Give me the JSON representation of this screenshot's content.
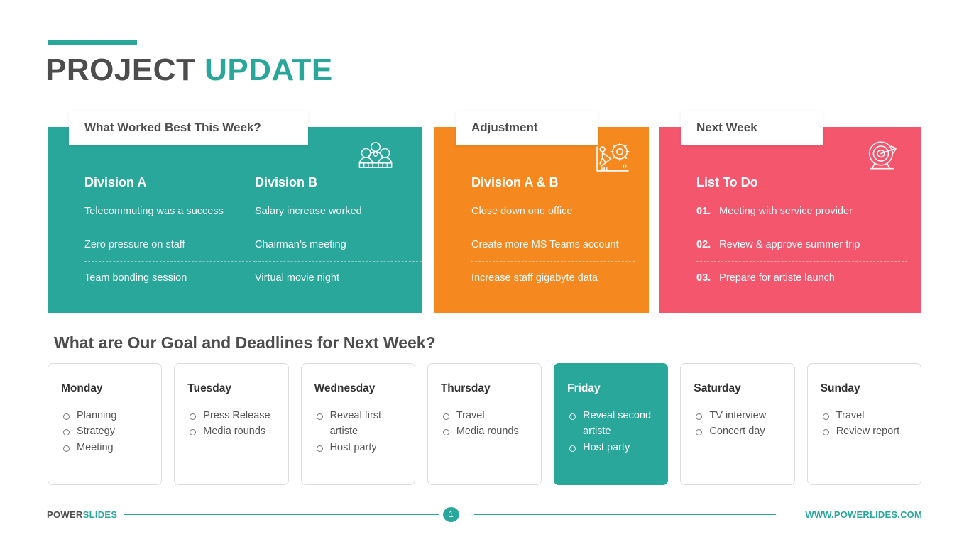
{
  "title": {
    "primary": "PROJECT",
    "accent": "UPDATE"
  },
  "colors": {
    "teal": "#2aa79b",
    "orange": "#f5891f",
    "pink": "#f4566e",
    "dark_text": "#4d4d4d"
  },
  "cards": [
    {
      "header": "What Worked Best This Week?",
      "icon": "team-people-icon",
      "color": "#2aa79b",
      "columns": [
        {
          "title": "Division A",
          "items": [
            "Telecommuting was a success",
            "Zero pressure on staff",
            "Team bonding session"
          ]
        },
        {
          "title": "Division B",
          "items": [
            "Salary increase worked",
            "Chairman’s meeting",
            "Virtual movie night"
          ]
        }
      ]
    },
    {
      "header": "Adjustment",
      "icon": "person-pushing-gear-icon",
      "color": "#f5891f",
      "columns": [
        {
          "title": "Division A & B",
          "items": [
            "Close down one office",
            "Create more MS Teams account",
            "Increase staff gigabyte data"
          ]
        }
      ]
    },
    {
      "header": "Next Week",
      "icon": "target-arrow-icon",
      "color": "#f4566e",
      "columns": [
        {
          "title": "List To Do",
          "numbered": true,
          "items": [
            {
              "num": "01.",
              "text": "Meeting with service provider"
            },
            {
              "num": "02.",
              "text": "Review & approve summer trip"
            },
            {
              "num": "03.",
              "text": "Prepare for artiste launch"
            }
          ]
        }
      ]
    }
  ],
  "section_heading": "What are Our Goal and Deadlines for Next Week?",
  "days": [
    {
      "name": "Monday",
      "active": false,
      "tasks": [
        "Planning",
        "Strategy",
        "Meeting"
      ]
    },
    {
      "name": "Tuesday",
      "active": false,
      "tasks": [
        "Press Release",
        "Media rounds"
      ]
    },
    {
      "name": "Wednesday",
      "active": false,
      "tasks": [
        "Reveal first artiste",
        "Host party"
      ]
    },
    {
      "name": "Thursday",
      "active": false,
      "tasks": [
        "Travel",
        "Media rounds"
      ]
    },
    {
      "name": "Friday",
      "active": true,
      "tasks": [
        "Reveal second artiste",
        "Host party"
      ]
    },
    {
      "name": "Saturday",
      "active": false,
      "tasks": [
        "TV interview",
        "Concert day"
      ]
    },
    {
      "name": "Sunday",
      "active": false,
      "tasks": [
        "Travel",
        "Review report"
      ]
    }
  ],
  "footer": {
    "brand_primary": "POWER",
    "brand_accent": "SLIDES",
    "page_number": "1",
    "url": "WWW.POWERLIDES.COM"
  }
}
